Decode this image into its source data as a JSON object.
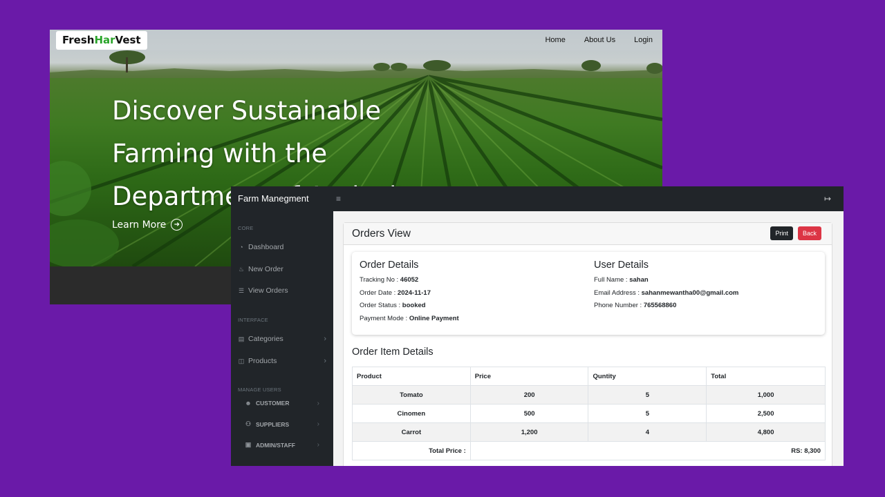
{
  "landing": {
    "logo": {
      "part1": "Fresh",
      "part2": "Har",
      "part3": "Vest"
    },
    "nav": [
      "Home",
      "About Us",
      "Login"
    ],
    "hero_lines": [
      "Discover Sustainable",
      "Farming with the",
      "Department of Agriculture"
    ],
    "learn_more": "Learn More"
  },
  "admin": {
    "brand": "Farm Manegment",
    "hamburger_icon": "bars-icon",
    "logout_icon": "sign-out-icon",
    "sidebar": {
      "core_heading": "CORE",
      "dashboard": "Dashboard",
      "new_order": "New Order",
      "view_orders": "View Orders",
      "interface_heading": "INTERFACE",
      "categories": "Categories",
      "products": "Products",
      "manage_heading": "MANAGE USERS",
      "customer": "CUSTOMER",
      "suppliers": "SUPPLIERS",
      "admin_staff": "ADMIN/STAFF"
    },
    "page_title": "Orders View",
    "print_label": "Print",
    "back_label": "Back",
    "order_details": {
      "heading": "Order Details",
      "tracking_label": "Tracking No : ",
      "tracking_value": "46052",
      "date_label": "Order Date : ",
      "date_value": "2024-11-17",
      "status_label": "Order Status : ",
      "status_value": "booked",
      "payment_label": "Payment Mode : ",
      "payment_value": "Online Payment"
    },
    "user_details": {
      "heading": "User Details",
      "name_label": "Full Name : ",
      "name_value": "sahan",
      "email_label": "Email Address : ",
      "email_value": "sahanmewantha00@gmail.com",
      "phone_label": "Phone Number : ",
      "phone_value": "765568860"
    },
    "items_title": "Order Item Details",
    "table": {
      "headers": [
        "Product",
        "Price",
        "Quntity",
        "Total"
      ],
      "rows": [
        [
          "Tomato",
          "200",
          "5",
          "1,000"
        ],
        [
          "Cinomen",
          "500",
          "5",
          "2,500"
        ],
        [
          "Carrot",
          "1,200",
          "4",
          "4,800"
        ]
      ],
      "total_label": "Total Price :",
      "total_value": "RS: 8,300"
    }
  }
}
